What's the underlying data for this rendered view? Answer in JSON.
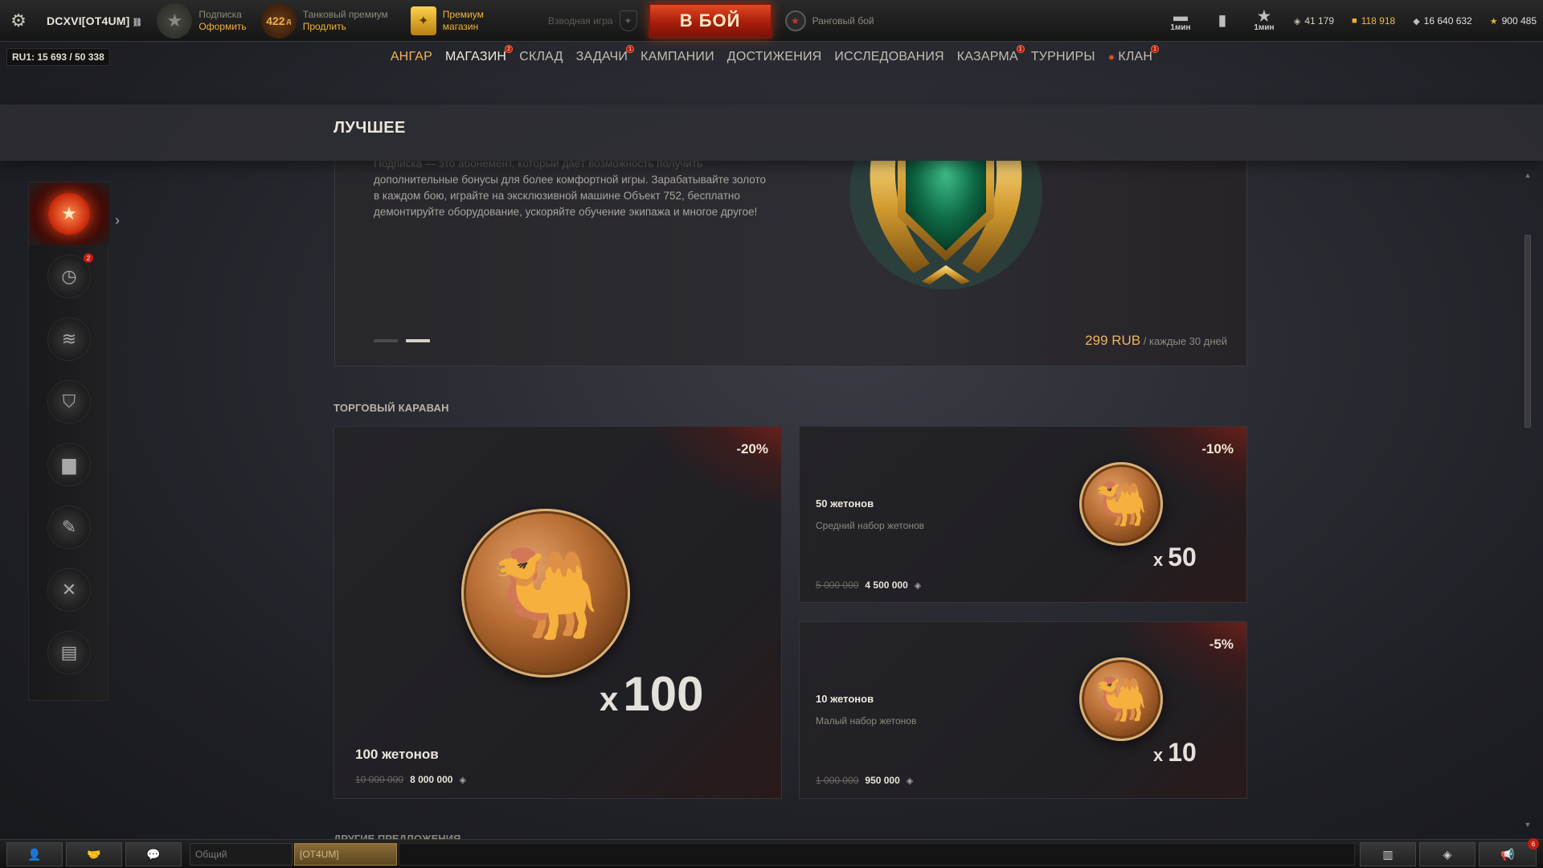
{
  "topbar": {
    "player_name": "DCXVI[OT4UM]",
    "subscription": {
      "label": "Подписка",
      "action": "Оформить"
    },
    "premium_tank": {
      "days": "422",
      "unit": "д",
      "label": "Танковый премиум",
      "action": "Продлить"
    },
    "premium_shop": {
      "line1": "Премиум",
      "line2": "магазин"
    },
    "platoon_label": "Взводная игра",
    "battle_button": "В БОЙ",
    "ranked_label": "Ранговый бой",
    "reserves": [
      {
        "label": "1мин"
      },
      {
        "label": ""
      },
      {
        "label": "1мин"
      }
    ],
    "currencies": {
      "credits": "41 179",
      "gold": "118 918",
      "free_xp": "16 640 632",
      "bonds": "900 485"
    }
  },
  "server_stats": "RU1: 15 693  /  50 338",
  "nav": [
    {
      "label": "Ангар",
      "state": "active",
      "badge": ""
    },
    {
      "label": "Магазин",
      "state": "selected",
      "badge": "2"
    },
    {
      "label": "Склад",
      "state": "",
      "badge": ""
    },
    {
      "label": "Задачи",
      "state": "",
      "badge": "1"
    },
    {
      "label": "Кампании",
      "state": "",
      "badge": ""
    },
    {
      "label": "Достижения",
      "state": "",
      "badge": ""
    },
    {
      "label": "Исследования",
      "state": "",
      "badge": ""
    },
    {
      "label": "Казарма",
      "state": "",
      "badge": "1"
    },
    {
      "label": "Турниры",
      "state": "",
      "badge": ""
    },
    {
      "label": "Клан",
      "state": "",
      "badge": "1"
    }
  ],
  "sidebar": {
    "items": [
      {
        "icon": "star-icon",
        "badge": ""
      },
      {
        "icon": "clock-icon",
        "badge": "2"
      },
      {
        "icon": "coins-icon",
        "badge": ""
      },
      {
        "icon": "shield-icon",
        "badge": ""
      },
      {
        "icon": "tank-icon",
        "badge": ""
      },
      {
        "icon": "brush-icon",
        "badge": ""
      },
      {
        "icon": "tools-icon",
        "badge": ""
      },
      {
        "icon": "money-icon",
        "badge": ""
      }
    ]
  },
  "section_title": "ЛУЧШЕЕ",
  "promo": {
    "text_faded": "Подписка — это абонемент, который даёт возможность получить",
    "text": "дополнительные бонусы для более комфортной игры. Зарабатывайте золото в каждом бою, играйте на эксклюзивной машине Объект 752, бесплатно демонтируйте оборудование, ускоряйте обучение экипажа и многое другое!",
    "price_amount": "299 RUB",
    "price_period": " / каждые 30 дней"
  },
  "caravan_title": "Торговый караван",
  "cards": [
    {
      "discount": "-20%",
      "name": "100 жетонов",
      "desc": "",
      "qty": "100",
      "old_price": "10 000 000",
      "new_price": "8 000 000"
    },
    {
      "discount": "-10%",
      "name": "50 жетонов",
      "desc": "Средний набор жетонов",
      "qty": "50",
      "old_price": "5 000 000",
      "new_price": "4 500 000"
    },
    {
      "discount": "-5%",
      "name": "10 жетонов",
      "desc": "Малый набор жетонов",
      "qty": "10",
      "old_price": "1 000 000",
      "new_price": "950 000"
    }
  ],
  "other_title": "Другие предложения",
  "bottombar": {
    "channel": "Общий",
    "clan_channel": "[OT4UM]",
    "notif_badge": "6"
  },
  "colors": {
    "accent": "#f0b35a",
    "battle": "#c42a10",
    "discount_glow": "#c82814"
  }
}
